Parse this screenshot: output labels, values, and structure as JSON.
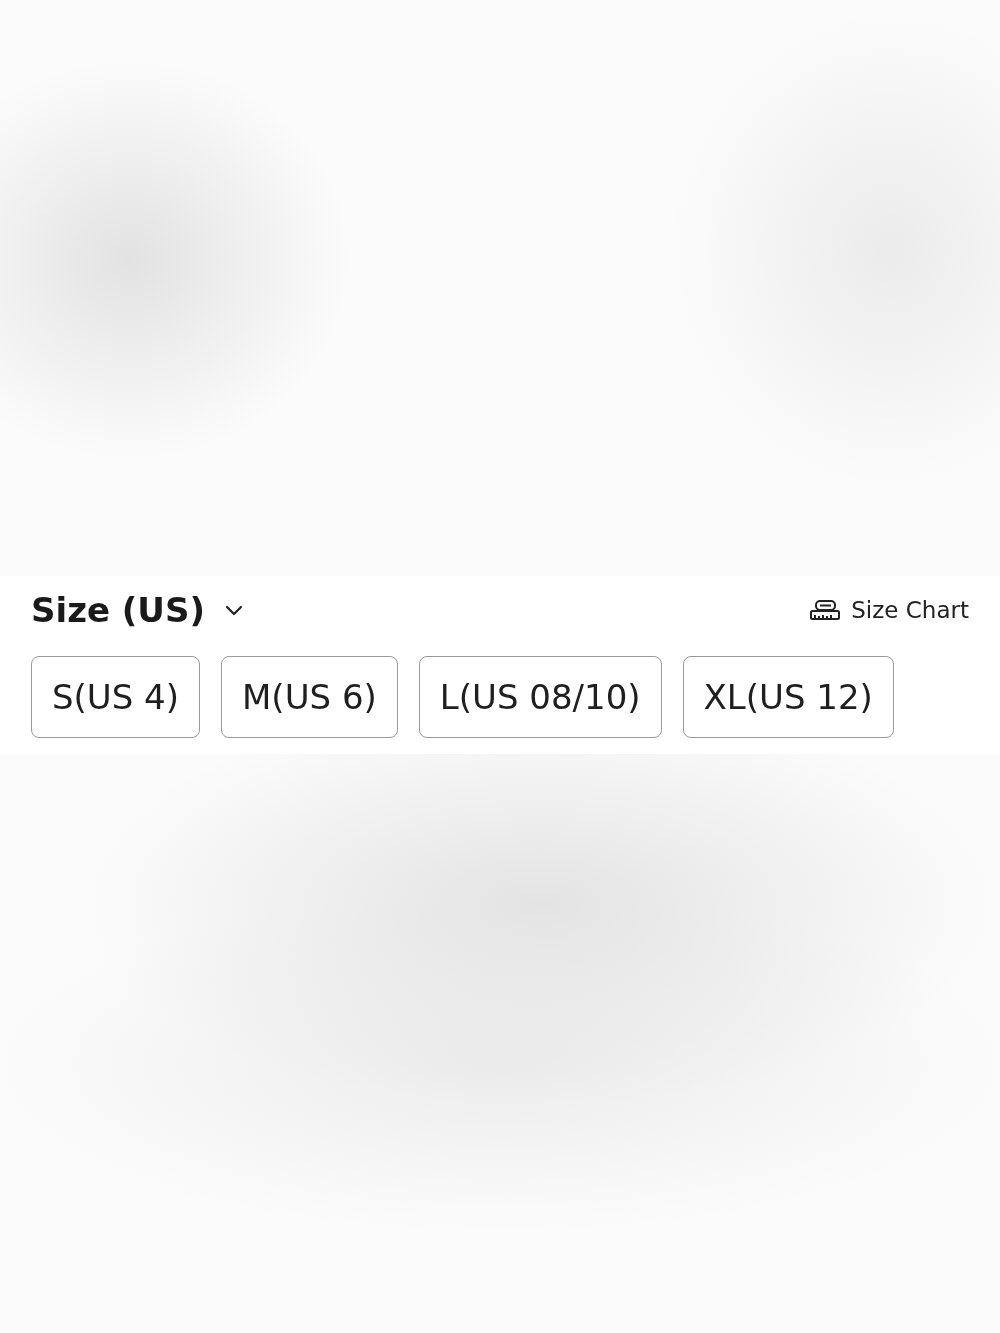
{
  "size_selector": {
    "title": "Size (US)",
    "expanded": false,
    "size_chart_link": "Size Chart",
    "options": [
      {
        "label": "S(US 4)",
        "selected": false
      },
      {
        "label": "M(US 6)",
        "selected": false
      },
      {
        "label": "L(US 08/10)",
        "selected": false
      },
      {
        "label": "XL(US 12)",
        "selected": false
      }
    ]
  }
}
